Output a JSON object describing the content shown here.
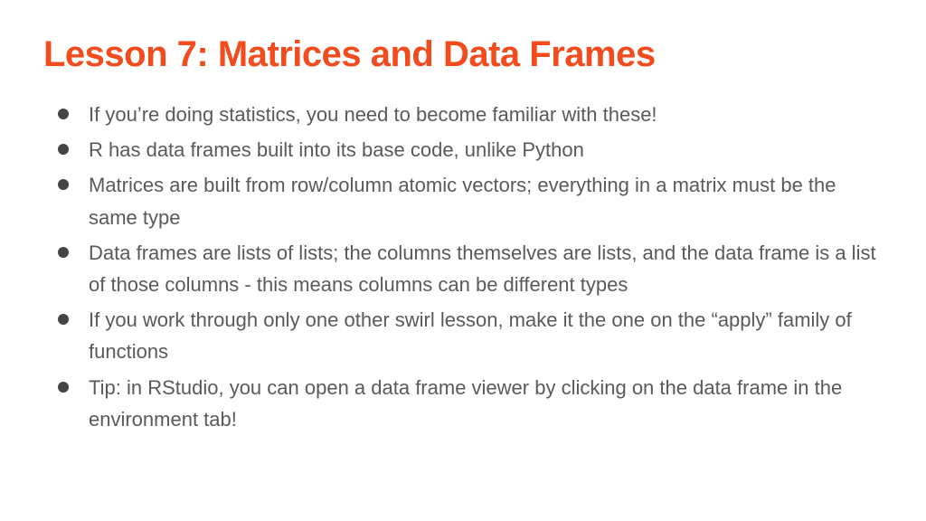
{
  "title": "Lesson 7: Matrices and Data Frames",
  "bullets": [
    "If you’re doing statistics, you need to become familiar with these!",
    "R has data frames built into its base code, unlike Python",
    "Matrices are built from row/column atomic vectors; everything in a matrix must be the same type",
    "Data frames are lists of lists; the columns themselves are lists, and the data frame is a list of those columns - this means columns can be different types",
    "If you work through only one other swirl lesson, make it the one on the “apply” family of functions",
    "Tip: in RStudio, you can open a data frame viewer by clicking on the data frame in the environment tab!"
  ],
  "colors": {
    "accent": "#f24c1e",
    "body_text": "#5a5a5a",
    "bullet_dot": "#444444"
  }
}
